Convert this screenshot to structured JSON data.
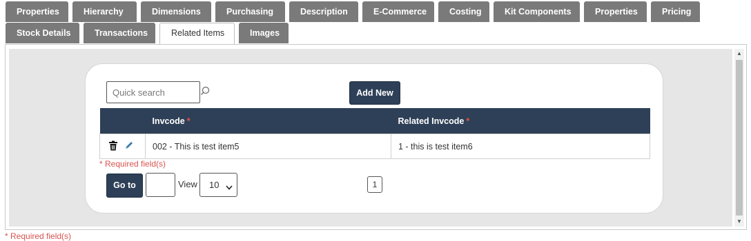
{
  "tabs_row1": [
    "Properties",
    "Hierarchy",
    "Dimensions",
    "Purchasing",
    "Description",
    "E-Commerce",
    "Costing",
    "Kit Components",
    "Properties",
    "Pricing"
  ],
  "tabs_row2": [
    "Stock Details",
    "Transactions",
    "Related Items",
    "Images"
  ],
  "active_tab": "Related Items",
  "search": {
    "placeholder": "Quick search",
    "icon": "search-icon"
  },
  "add_new_label": "Add New",
  "grid": {
    "columns": [
      {
        "label": "Invcode",
        "required_mark": "*"
      },
      {
        "label": "Related Invcode",
        "required_mark": "*"
      }
    ],
    "rows": [
      {
        "invcode": "002 - This is test item5",
        "related_invcode": "1 - this is test item6"
      }
    ],
    "row_icons": [
      "trash-icon",
      "pencil-icon"
    ]
  },
  "required_note": "* Required field(s)",
  "goto_label": "Go to",
  "page_input_value": "",
  "view_label": "View",
  "view_value": "10",
  "current_page": "1",
  "bottom_required_note": "* Required field(s)",
  "colors": {
    "header_bg": "#2e4057",
    "tab_bg": "#7a7a7a",
    "required": "#d9534f"
  }
}
